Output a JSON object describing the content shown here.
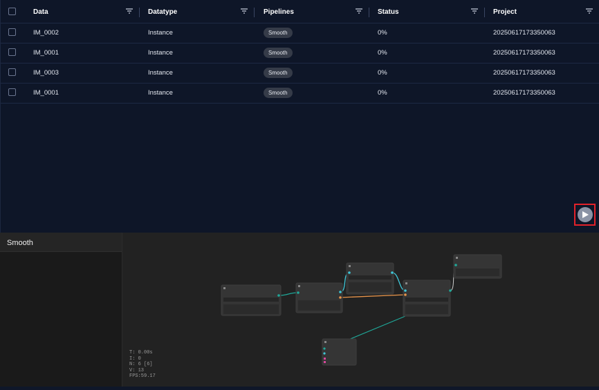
{
  "table": {
    "columns": [
      {
        "label": "Data"
      },
      {
        "label": "Datatype"
      },
      {
        "label": "Pipelines"
      },
      {
        "label": "Status"
      },
      {
        "label": "Project"
      }
    ],
    "rows": [
      {
        "data": "IM_0002",
        "datatype": "Instance",
        "pipeline": "Smooth",
        "status": "0%",
        "project": "20250617173350063"
      },
      {
        "data": "IM_0001",
        "datatype": "Instance",
        "pipeline": "Smooth",
        "status": "0%",
        "project": "20250617173350063"
      },
      {
        "data": "IM_0003",
        "datatype": "Instance",
        "pipeline": "Smooth",
        "status": "0%",
        "project": "20250617173350063"
      },
      {
        "data": "IM_0001",
        "datatype": "Instance",
        "pipeline": "Smooth",
        "status": "0%",
        "project": "20250617173350063"
      }
    ]
  },
  "run_button": {
    "icon": "play-icon"
  },
  "editor": {
    "panel_title": "Smooth",
    "stats": {
      "t": "T: 0.00s",
      "i": "I: 0",
      "n": "N: 6 [6]",
      "v": "V: 13",
      "fps": "FPS:59.17"
    }
  },
  "colors": {
    "table_bg": "#0e1628",
    "editor_bg": "#222222",
    "link_cyan": "#3fc7d8",
    "link_orange": "#e8944a",
    "link_teal": "#1fa99a",
    "highlight": "#e3222a"
  }
}
